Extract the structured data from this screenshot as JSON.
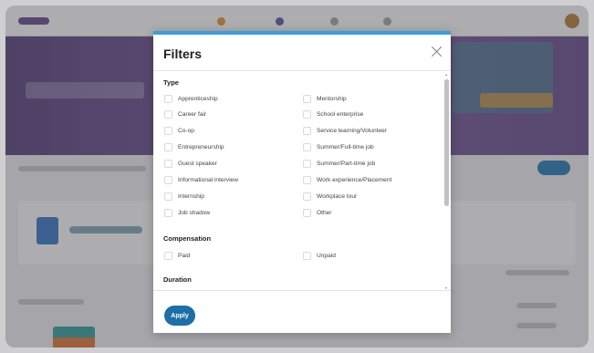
{
  "modal": {
    "title": "Filters",
    "apply_label": "Apply"
  },
  "sections": {
    "type": {
      "title": "Type",
      "left": [
        "Apprenticeship",
        "Career fair",
        "Co-op",
        "Entrepreneurship",
        "Guest speaker",
        "Informational interview",
        "Internship",
        "Job shadow"
      ],
      "right": [
        "Mentorship",
        "School enterprise",
        "Service learning/Volunteer",
        "Summer/Full-time job",
        "Summer/Part-time job",
        "Work experience/Placement",
        "Workplace tour",
        "Other"
      ]
    },
    "compensation": {
      "title": "Compensation",
      "left": [
        "Paid"
      ],
      "right": [
        "Unpaid"
      ]
    },
    "duration": {
      "title": "Duration"
    }
  },
  "colors": {
    "accent_bar": "#3b9fd8",
    "apply_button": "#1d6fa5"
  }
}
